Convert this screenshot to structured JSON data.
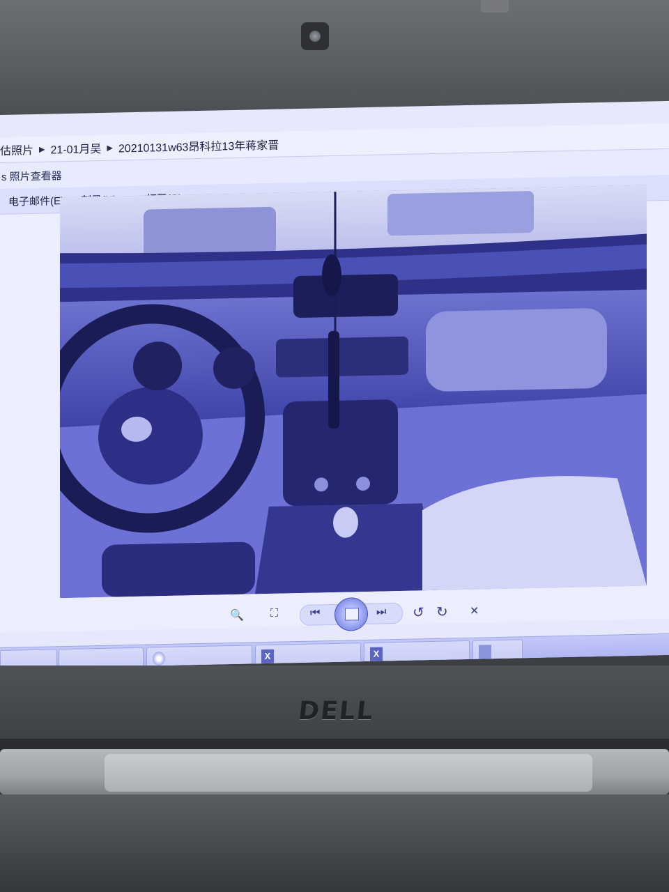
{
  "laptop": {
    "brand": "DELL"
  },
  "explorer": {
    "breadcrumbs": [
      "估照片",
      "21-01月吴",
      "20210131w63昂科拉13年蒋家晋"
    ]
  },
  "viewer": {
    "title": "s 照片查看器",
    "menu": [
      {
        "label": "电子邮件(E)",
        "has_dropdown": false
      },
      {
        "label": "刻录(U)",
        "has_dropdown": true
      },
      {
        "label": "打开(O)",
        "has_dropdown": true
      }
    ],
    "photo": {
      "description_icon": "car-interior-photo"
    },
    "controls": {
      "zoom": "🔍",
      "fit": "⛶",
      "prev": "⏮",
      "next": "⏭",
      "rotate_ccw": "↺",
      "rotate_cw": "↻",
      "delete": "✕"
    }
  },
  "taskbar": {
    "items": [
      {
        "icon": "window-icon"
      },
      {
        "icon": "window-icon"
      },
      {
        "icon": "edge-icon"
      },
      {
        "icon": "excel-icon",
        "glyph": "X"
      },
      {
        "icon": "excel-icon",
        "glyph": "X"
      },
      {
        "icon": "photo-viewer-icon"
      }
    ]
  }
}
